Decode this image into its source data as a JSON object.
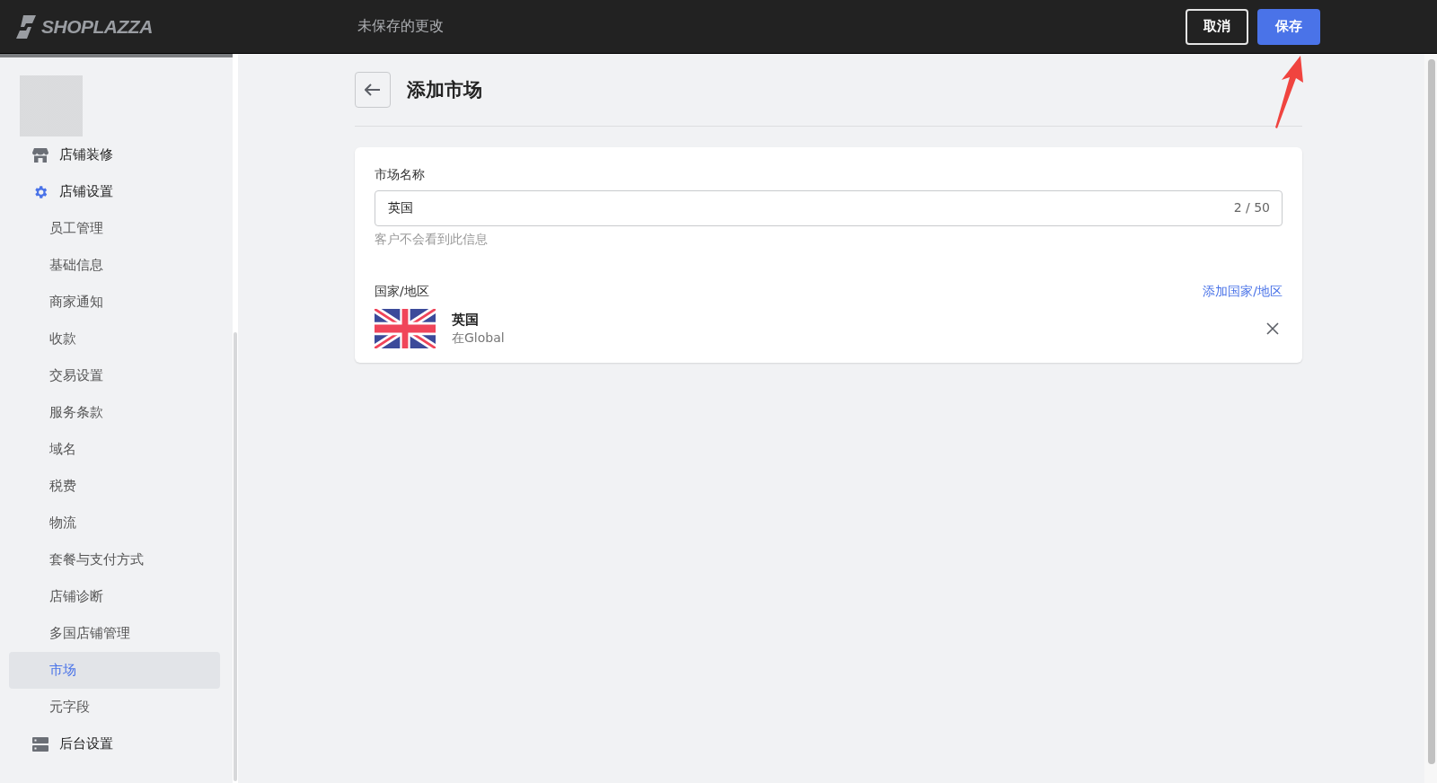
{
  "header": {
    "brand": "SHOPLAZZA",
    "status": "未保存的更改",
    "buttons": [
      {
        "label": "取消",
        "kind": "secondary"
      },
      {
        "label": "保存",
        "kind": "primary"
      }
    ]
  },
  "sidebar": {
    "items": [
      {
        "label": "店铺装修",
        "kind": "store",
        "selected": false
      },
      {
        "label": "店铺设置",
        "kind": "gear",
        "selected": false,
        "children": [
          {
            "label": "员工管理",
            "selected": false
          },
          {
            "label": "基础信息",
            "selected": false
          },
          {
            "label": "商家通知",
            "selected": false
          },
          {
            "label": "收款",
            "selected": false
          },
          {
            "label": "交易设置",
            "selected": false
          },
          {
            "label": "服务条款",
            "selected": false
          },
          {
            "label": "域名",
            "selected": false
          },
          {
            "label": "税费",
            "selected": false
          },
          {
            "label": "物流",
            "selected": false
          },
          {
            "label": "套餐与支付方式",
            "selected": false
          },
          {
            "label": "店铺诊断",
            "selected": false
          },
          {
            "label": "多国店铺管理",
            "selected": false
          },
          {
            "label": "市场",
            "selected": true
          },
          {
            "label": "元字段",
            "selected": false
          }
        ]
      },
      {
        "label": "后台设置",
        "kind": "server",
        "selected": false
      }
    ]
  },
  "page": {
    "title": "添加市场",
    "name_field": {
      "label": "市场名称",
      "value": "英国",
      "counter": "2 / 50",
      "help": "客户不会看到此信息"
    },
    "regions": {
      "label": "国家/地区",
      "add_link": "添加国家/地区",
      "items": [
        {
          "name": "英国",
          "group": "在Global"
        }
      ]
    }
  },
  "annotation": {
    "kind": "arrow"
  }
}
